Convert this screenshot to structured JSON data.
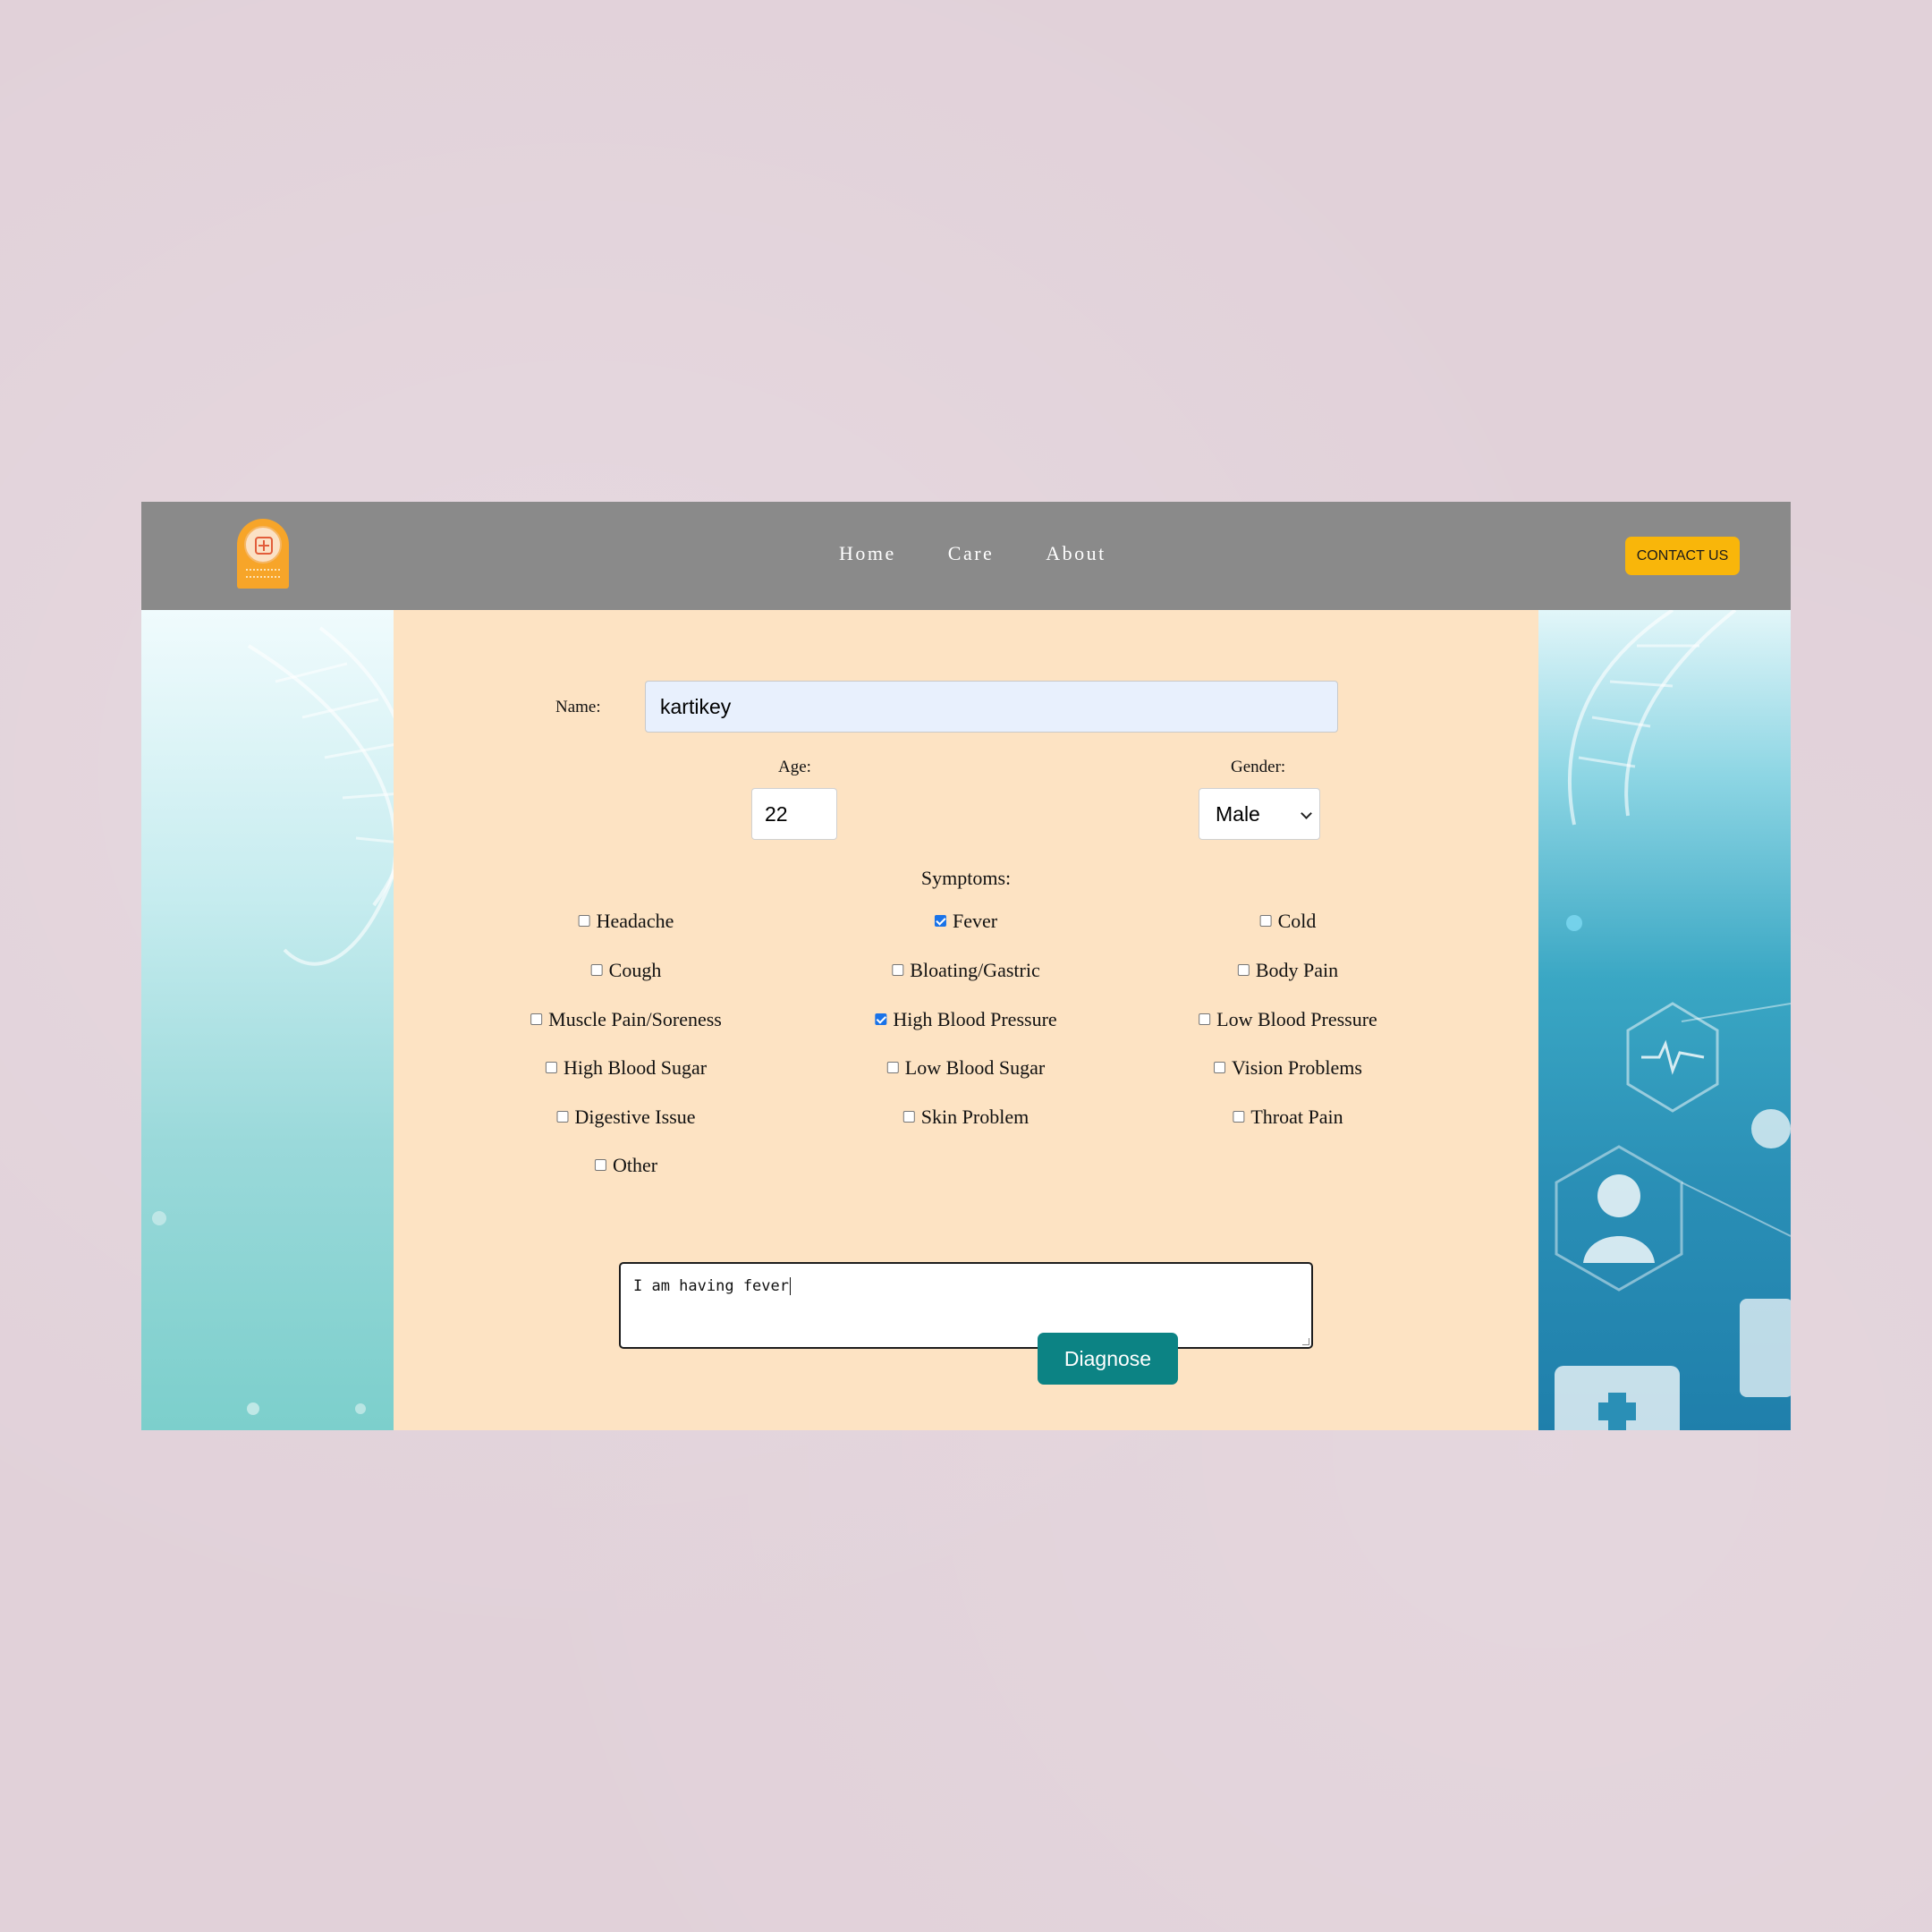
{
  "nav": {
    "links": [
      "Home",
      "Care",
      "About"
    ],
    "contact_label": "CONTACT US"
  },
  "form": {
    "name_label": "Name:",
    "name_value": "kartikey",
    "age_label": "Age:",
    "age_value": "22",
    "gender_label": "Gender:",
    "gender_value": "Male",
    "symptoms_title": "Symptoms:",
    "symptoms": [
      {
        "label": "Headache",
        "checked": false
      },
      {
        "label": "Fever",
        "checked": true
      },
      {
        "label": "Cold",
        "checked": false
      },
      {
        "label": "Cough",
        "checked": false
      },
      {
        "label": "Bloating/Gastric",
        "checked": false
      },
      {
        "label": "Body Pain",
        "checked": false
      },
      {
        "label": "Muscle Pain/Soreness",
        "checked": false
      },
      {
        "label": "High Blood Pressure",
        "checked": true
      },
      {
        "label": "Low Blood Pressure",
        "checked": false
      },
      {
        "label": "High Blood Sugar",
        "checked": false
      },
      {
        "label": "Low Blood Sugar",
        "checked": false
      },
      {
        "label": "Vision Problems",
        "checked": false
      },
      {
        "label": "Digestive Issue",
        "checked": false
      },
      {
        "label": "Skin Problem",
        "checked": false
      },
      {
        "label": "Throat Pain",
        "checked": false
      },
      {
        "label": "Other",
        "checked": false
      }
    ],
    "notes_value": "I am having fever",
    "diagnose_label": "Diagnose"
  },
  "colors": {
    "navbar": "#8a8a8a",
    "contact_button": "#f9b60a",
    "form_panel": "#fde3c3",
    "diagnose_button": "#0c8384",
    "checkbox_checked": "#1a73e8"
  },
  "icons": {
    "logo": "medical-cross-logo-icon",
    "select": "chevron-down-icon"
  }
}
